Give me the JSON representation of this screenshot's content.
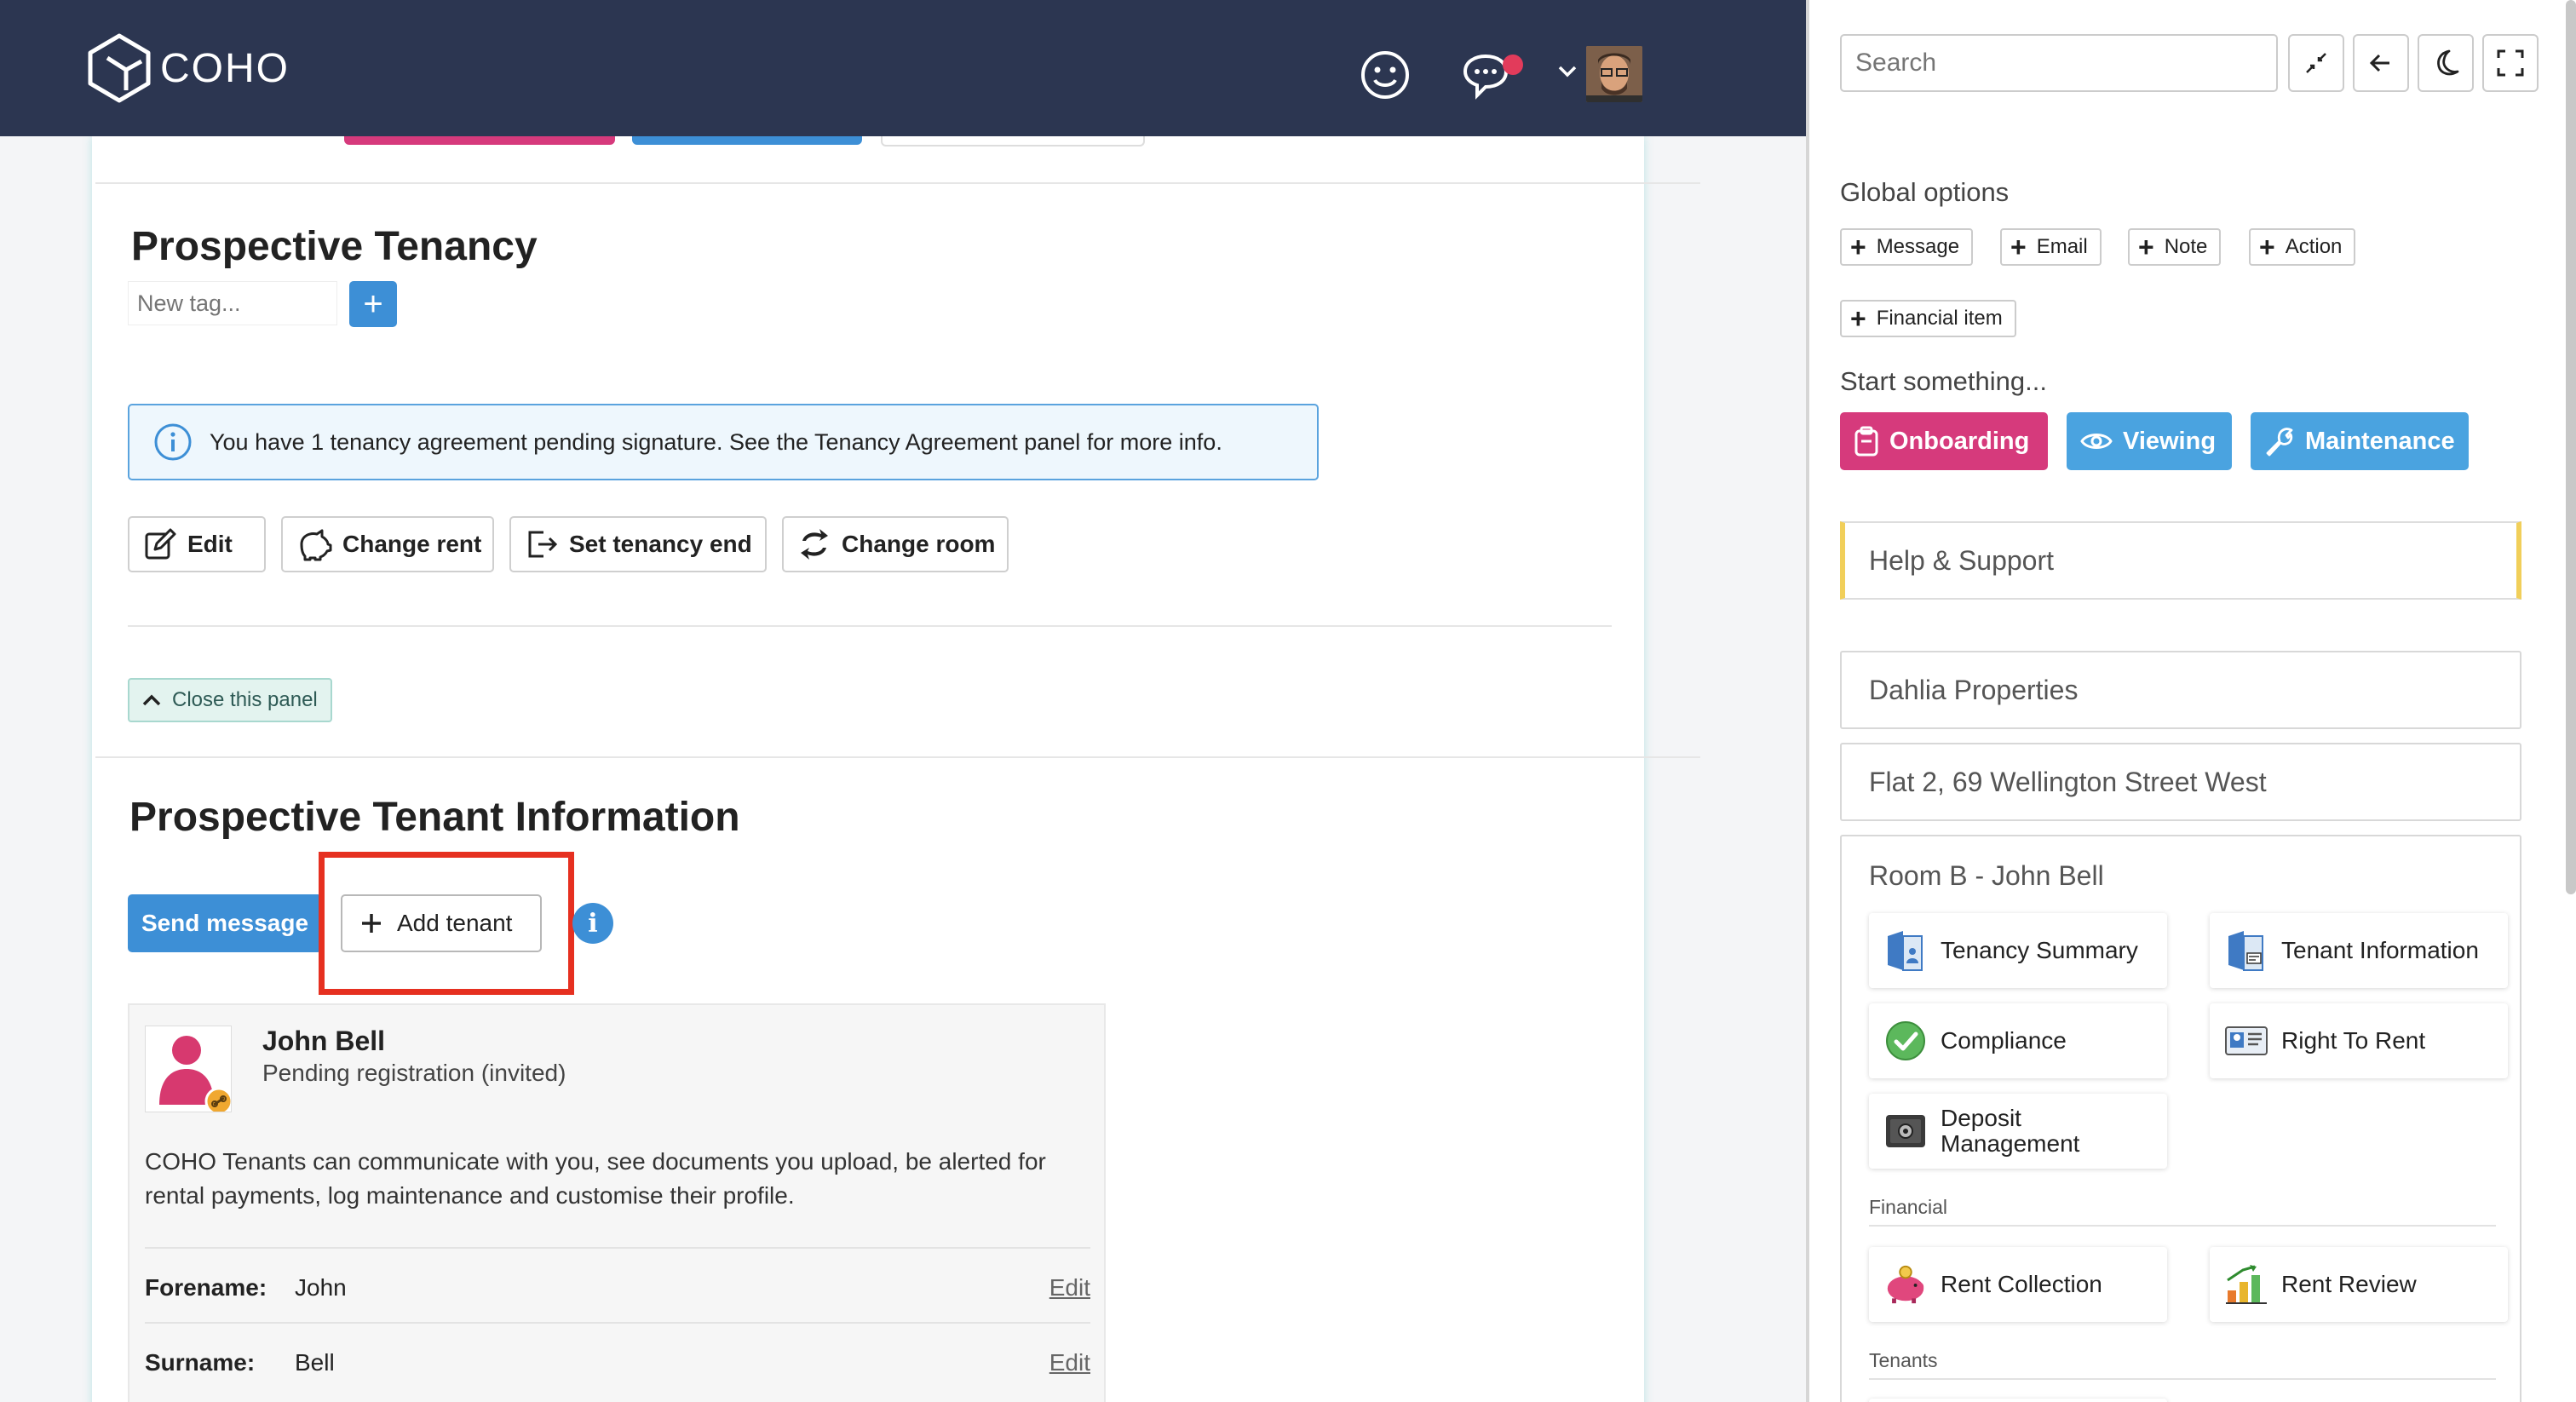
{
  "header": {
    "logo_text": "COHO",
    "colors": {
      "topbar": "#2c3651",
      "accent": "#3d8fd6",
      "notification": "#e23b5b"
    },
    "icons": [
      "smiley-icon",
      "chat-bubbles-icon",
      "chevron-down-icon"
    ]
  },
  "tenancy": {
    "title": "Prospective Tenancy",
    "tag_placeholder": "New tag...",
    "tag_add_label": "+",
    "info_text": "You have 1 tenancy agreement pending signature. See the Tenancy Agreement panel for more info.",
    "actions": [
      {
        "label": "Edit",
        "icon": "edit-icon"
      },
      {
        "label": "Change rent",
        "icon": "piggy-icon"
      },
      {
        "label": "Set tenancy end",
        "icon": "exit-icon"
      },
      {
        "label": "Change room",
        "icon": "swap-icon"
      }
    ],
    "close_panel": "Close this panel"
  },
  "tenant_info": {
    "title": "Prospective Tenant Information",
    "send_message": "Send message",
    "add_tenant": "Add tenant",
    "info_icon": "i",
    "tenant": {
      "name": "John Bell",
      "status": "Pending registration (invited)",
      "description": "COHO Tenants can communicate with you, see documents you upload, be alerted for rental payments, log maintenance and customise their profile.",
      "fields": [
        {
          "key": "Forename:",
          "value": "John",
          "edit": "Edit"
        },
        {
          "key": "Surname:",
          "value": "Bell",
          "edit": "Edit"
        }
      ]
    }
  },
  "sidebar": {
    "search_placeholder": "Search",
    "global_options_label": "Global options",
    "global_options": [
      "Message",
      "Email",
      "Note",
      "Action",
      "Financial item"
    ],
    "start_label": "Start something...",
    "start_buttons": [
      {
        "label": "Onboarding",
        "color": "#d63a7c",
        "icon": "clipboard-icon"
      },
      {
        "label": "Viewing",
        "color": "#4aa3e0",
        "icon": "eye-icon"
      },
      {
        "label": "Maintenance",
        "color": "#4aa3e0",
        "icon": "wrench-icon"
      }
    ],
    "help": "Help & Support",
    "crumbs": [
      "Dahlia Properties",
      "Flat 2, 69 Wellington Street West"
    ],
    "room": {
      "title": "Room B - John Bell",
      "tiles": [
        {
          "label": "Tenancy Summary",
          "icon": "tenancy-summary-icon"
        },
        {
          "label": "Tenant Information",
          "icon": "tenant-information-icon"
        },
        {
          "label": "Compliance",
          "icon": "check-circle-icon"
        },
        {
          "label": "Right To Rent",
          "icon": "id-card-icon"
        },
        {
          "label": "Deposit Management",
          "icon": "safe-icon"
        }
      ],
      "financial_label": "Financial",
      "financial_tiles": [
        {
          "label": "Rent Collection",
          "icon": "piggy-bank-icon"
        },
        {
          "label": "Rent Review",
          "icon": "bar-chart-icon"
        }
      ],
      "tenants_label": "Tenants"
    }
  }
}
